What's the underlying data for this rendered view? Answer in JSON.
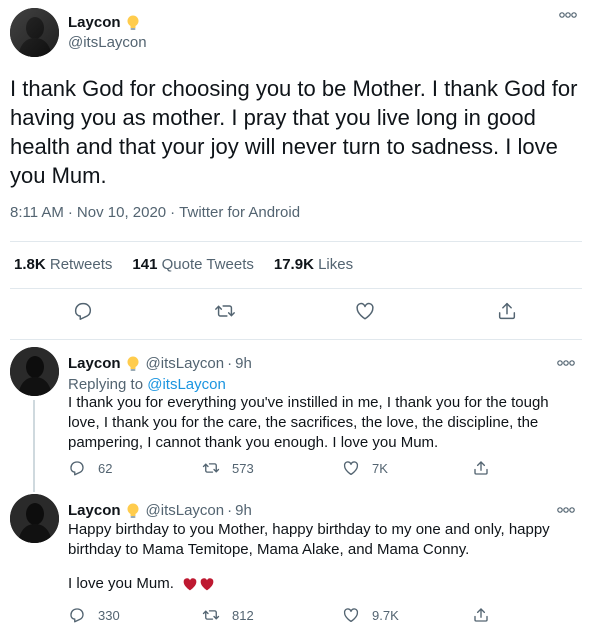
{
  "main": {
    "author": {
      "name": "Laycon",
      "handle": "@itsLaycon"
    },
    "text": "I thank God for choosing you to be Mother. I thank God for having you as mother. I pray that you live long in good health and that your joy will never turn to sadness. I love you Mum.",
    "time": "8:11 AM",
    "date": "Nov 10, 2020",
    "separator": "·",
    "source": "Twitter for Android",
    "stats": {
      "retweets": {
        "count": "1.8K",
        "label": "Retweets"
      },
      "quotes": {
        "count": "141",
        "label": "Quote Tweets"
      },
      "likes": {
        "count": "17.9K",
        "label": "Likes"
      }
    }
  },
  "replies": [
    {
      "name": "Laycon",
      "handle": "@itsLaycon",
      "dot": "·",
      "time": "9h",
      "replying_prefix": "Replying to",
      "replying_to": "@itsLaycon",
      "text": "I thank you for everything you've instilled in me, I thank you for the tough love, I thank you for the care, the sacrifices, the love, the discipline, the pampering, I cannot thank you enough. I love you Mum.",
      "replies": "62",
      "retweets": "573",
      "likes": "7K"
    },
    {
      "name": "Laycon",
      "handle": "@itsLaycon",
      "dot": "·",
      "time": "9h",
      "text": "Happy birthday to you Mother, happy birthday to my one and only, happy birthday to Mama Temitope, Mama Alake, and Mama Conny.",
      "text2": "I love you Mum.",
      "replies": "330",
      "retweets": "812",
      "likes": "9.7K"
    }
  ],
  "colors": {
    "secondary": "#536471",
    "link": "#1b95e0",
    "heart": "#be1931",
    "divider": "#e1e8ed"
  },
  "icons": [
    "lightbulb-icon",
    "more-icon",
    "reply-icon",
    "retweet-icon",
    "like-icon",
    "share-icon",
    "red-heart-icon"
  ]
}
